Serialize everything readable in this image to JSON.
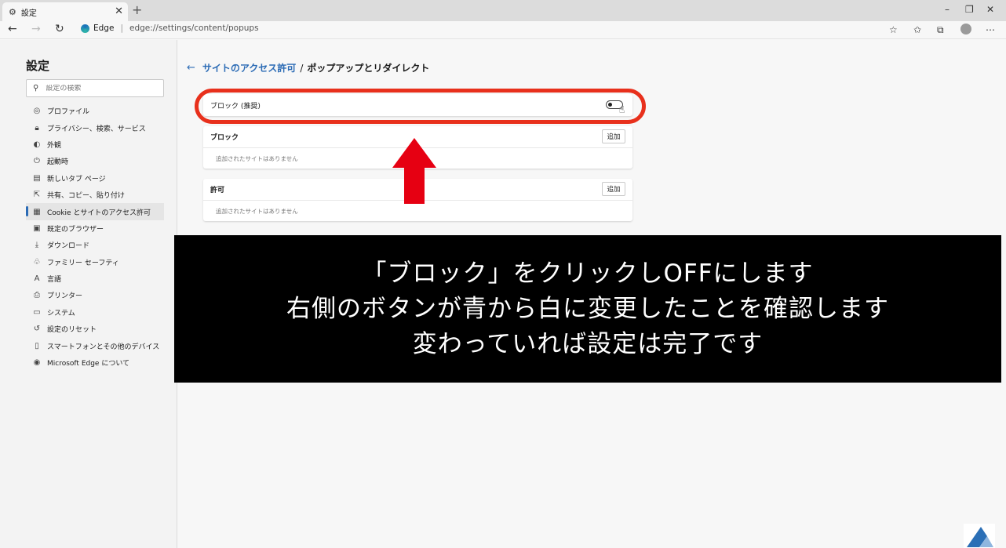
{
  "browser": {
    "tab_title": "設定",
    "url_brand": "Edge",
    "url": "edge://settings/content/popups"
  },
  "sidebar": {
    "title": "設定",
    "search_placeholder": "設定の検索",
    "items": [
      {
        "label": "プロファイル",
        "icon": "profile-icon"
      },
      {
        "label": "プライバシー、検索、サービス",
        "icon": "lock-icon"
      },
      {
        "label": "外観",
        "icon": "appearance-icon"
      },
      {
        "label": "起動時",
        "icon": "power-icon"
      },
      {
        "label": "新しいタブ ページ",
        "icon": "new-tab-icon"
      },
      {
        "label": "共有、コピー、貼り付け",
        "icon": "share-icon"
      },
      {
        "label": "Cookie とサイトのアクセス許可",
        "icon": "cookie-site-icon",
        "active": true
      },
      {
        "label": "既定のブラウザー",
        "icon": "browser-icon"
      },
      {
        "label": "ダウンロード",
        "icon": "download-icon"
      },
      {
        "label": "ファミリー セーフティ",
        "icon": "family-icon"
      },
      {
        "label": "言語",
        "icon": "language-icon"
      },
      {
        "label": "プリンター",
        "icon": "printer-icon"
      },
      {
        "label": "システム",
        "icon": "system-icon"
      },
      {
        "label": "設定のリセット",
        "icon": "reset-icon"
      },
      {
        "label": "スマートフォンとその他のデバイス",
        "icon": "phone-icon"
      },
      {
        "label": "Microsoft Edge について",
        "icon": "edge-logo-icon"
      }
    ]
  },
  "main": {
    "breadcrumb_parent": "サイトのアクセス許可",
    "breadcrumb_separator": "/",
    "breadcrumb_current": "ポップアップとリダイレクト",
    "block_recommended_label": "ブロック (推奨)",
    "block_recommended_toggle": "off",
    "block_section": {
      "title": "ブロック",
      "add_label": "追加",
      "empty_text": "追加されたサイトはありません"
    },
    "allow_section": {
      "title": "許可",
      "add_label": "追加",
      "empty_text": "追加されたサイトはありません"
    }
  },
  "annotation": {
    "ring_color": "#e8301c",
    "arrow_color": "#e60012",
    "lines": [
      "「ブロック」をクリックしOFFにします",
      "右側のボタンが青から白に変更したことを確認します",
      "変わっていれば設定は完了です"
    ]
  }
}
